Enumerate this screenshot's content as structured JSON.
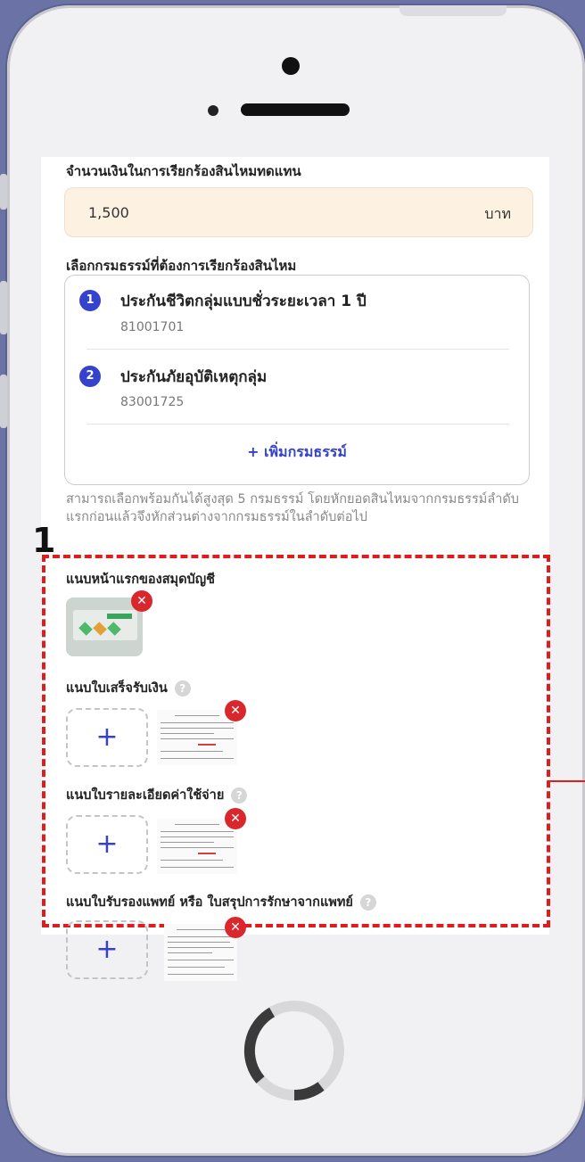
{
  "claim": {
    "amount_label": "จำนวนเงินในการเรียกร้องสินไหมทดแทน",
    "amount_value": "1,500",
    "amount_unit": "บาท"
  },
  "policies": {
    "label": "เลือกกรมธรรม์ที่ต้องการเรียกร้องสินไหม",
    "items": [
      {
        "number": "1",
        "name": "ประกันชีวิตกลุ่มแบบชั่วระยะเวลา 1 ปี",
        "code": "81001701"
      },
      {
        "number": "2",
        "name": "ประกันภัยอุบัติเหตุกลุ่ม",
        "code": "83001725"
      }
    ],
    "add_label": "+ เพิ่มกรมธรรม์",
    "note": "สามารถเลือกพร้อมกันได้สูงสุด 5 กรมธรรม์ โดยหักยอดสินไหมจากกรมธรรม์ลำดับแรกก่อนแล้วจึงหักส่วนต่างจากกรมธรรม์ในลำดับต่อไป"
  },
  "annotation": {
    "marker": "1",
    "color": "#e01c1c"
  },
  "attachments": {
    "bankbook_label": "แนบหน้าแรกของสมุดบัญชี",
    "receipt_label": "แนบใบเสร็จรับเงิน",
    "expense_label": "แนบใบรายละเอียดค่าใช้จ่าย",
    "medical_label": "แนบใบรับรองแพทย์ หรือ ใบสรุปการรักษาจากแพทย์",
    "help_glyph": "?",
    "add_glyph": "+",
    "remove_glyph": "✕"
  },
  "colors": {
    "accent": "#3442cc",
    "amount_bg": "#fdf1e2",
    "remove": "#d8282e"
  }
}
